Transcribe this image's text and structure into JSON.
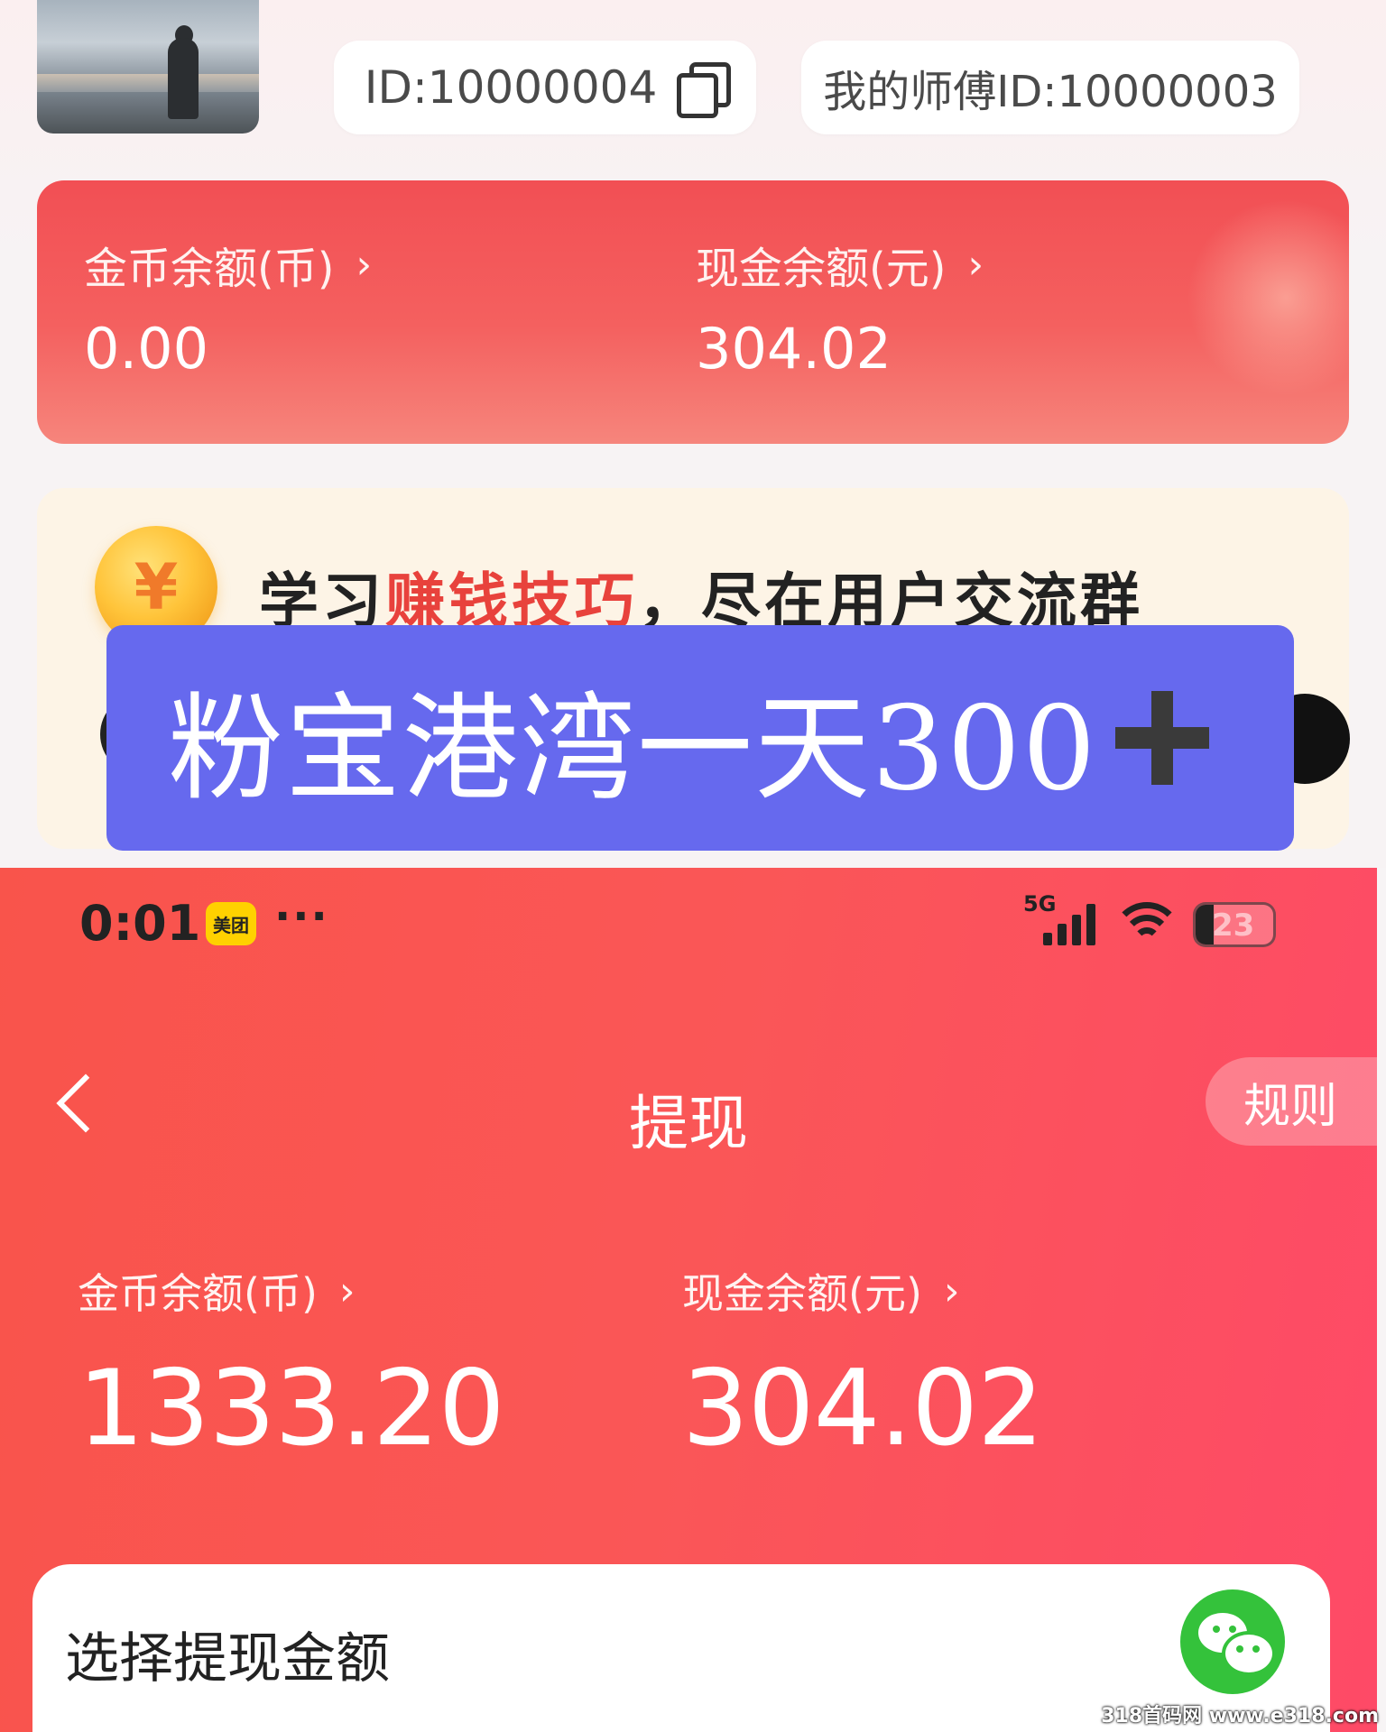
{
  "profile": {
    "user_id_text": "ID:10000004",
    "master_id_text": "我的师傅ID:10000003"
  },
  "top_balance": {
    "coin_label": "金币余额(币)",
    "coin_value": "0.00",
    "cash_label": "现金余额(元)",
    "cash_value": "304.02",
    "chevron": "›"
  },
  "tip": {
    "coin_symbol": "¥",
    "text_before": "学习",
    "text_highlight": "赚钱技巧",
    "text_after": "，尽在用户交流群"
  },
  "promo": {
    "text": "粉宝港湾一天300"
  },
  "status_bar": {
    "time": "0:01",
    "app_badge": "美团",
    "more": "···",
    "network": "5G",
    "battery_percent": 23,
    "battery_text": "23"
  },
  "withdraw_page": {
    "title": "提现",
    "rules_label": "规则",
    "coin_label": "金币余额(币)",
    "coin_value": "1333.20",
    "cash_label": "现金余额(元)",
    "cash_value": "304.02",
    "chevron": "›",
    "select_amount_label": "选择提现金额"
  },
  "watermark": "318首码网 www.e318.com",
  "colors": {
    "card_red": "#f24f54",
    "page_red": "#fa5657",
    "promo_purple": "#6669ee",
    "highlight_red": "#e8423c",
    "wechat_green": "#34c23b"
  }
}
